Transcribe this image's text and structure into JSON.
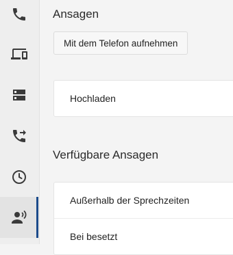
{
  "colors": {
    "accent": "#1a4a8a",
    "sidebar_bg": "#eeeeee",
    "page_bg": "#f4f4f4"
  },
  "sidebar": {
    "items": [
      {
        "icon": "phone-icon",
        "active": false
      },
      {
        "icon": "devices-icon",
        "active": false
      },
      {
        "icon": "server-icon",
        "active": false
      },
      {
        "icon": "call-forward-icon",
        "active": false
      },
      {
        "icon": "clock-icon",
        "active": false
      },
      {
        "icon": "voice-announcement-icon",
        "active": true
      }
    ]
  },
  "announcements": {
    "title": "Ansagen",
    "record_button": "Mit dem Telefon aufnehmen",
    "upload_label": "Hochladen"
  },
  "available": {
    "title": "Verfügbare Ansagen",
    "items": [
      "Außerhalb der Sprechzeiten",
      "Bei besetzt"
    ]
  }
}
